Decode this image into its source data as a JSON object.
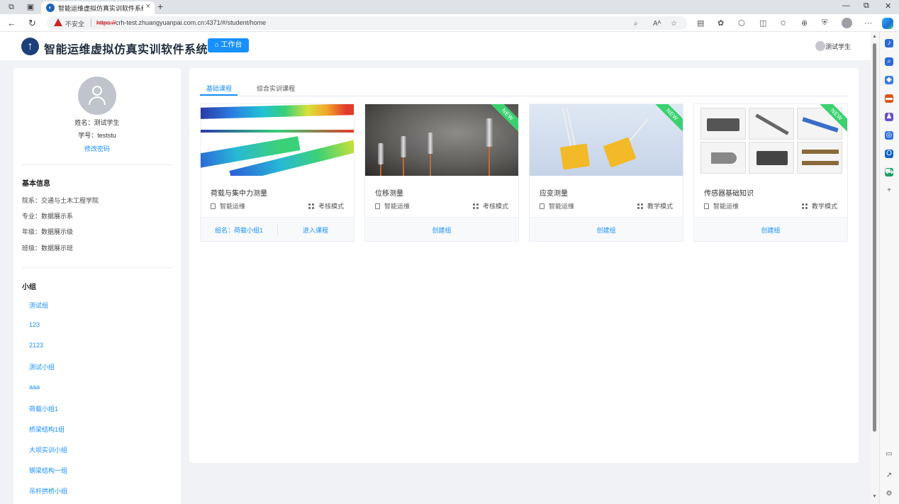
{
  "browser": {
    "tab_title": "智能运维虚拟仿真实训软件系统",
    "tab_close": "×",
    "new_tab": "+",
    "security_label": "不安全",
    "url_scheme": "https://",
    "url_rest": "crh-test.zhuangyuanpai.com.cn:4371/#/student/home",
    "read_aloud": "Aᴬ"
  },
  "header": {
    "system_title": "智能运维虚拟仿真实训软件系统",
    "workbench_label": "工作台",
    "user_name": "测试学生"
  },
  "profile": {
    "name_line": "姓名：测试学生",
    "id_line": "学号：teststu",
    "change_password": "修改密码"
  },
  "basic_info": {
    "heading": "基本信息",
    "rows": [
      "院系：交通与土木工程学院",
      "专业：数据展示系",
      "年级：数据展示级",
      "班级：数据展示班"
    ]
  },
  "groups": {
    "heading": "小组",
    "items": [
      "测试组",
      "123",
      "2123",
      "测试小组",
      "aaa",
      "荷载小组1",
      "桥梁结构1组",
      "大坝实训小组",
      "钢梁结构一组",
      "吊杆拱桥小组"
    ]
  },
  "tabs": [
    "基础课程",
    "综合实训课程"
  ],
  "cards": [
    {
      "title": "荷载与集中力测量",
      "tag": "智能运维",
      "mode": "考核模式",
      "ribbon": "",
      "footer_left": "组名：荷载小组1",
      "footer_right": "进入课程"
    },
    {
      "title": "位移测量",
      "tag": "智能运维",
      "mode": "考核模式",
      "ribbon": "NEW",
      "footer": "创建组"
    },
    {
      "title": "应变测量",
      "tag": "智能运维",
      "mode": "教学模式",
      "ribbon": "NEW",
      "footer": "创建组"
    },
    {
      "title": "传感器基础知识",
      "tag": "智能运维",
      "mode": "教学模式",
      "ribbon": "NEW",
      "footer": "创建组"
    }
  ],
  "colors": {
    "primary": "#1890ff",
    "ribbon": "#3bd16f",
    "page_bg": "#f0f2f5"
  }
}
